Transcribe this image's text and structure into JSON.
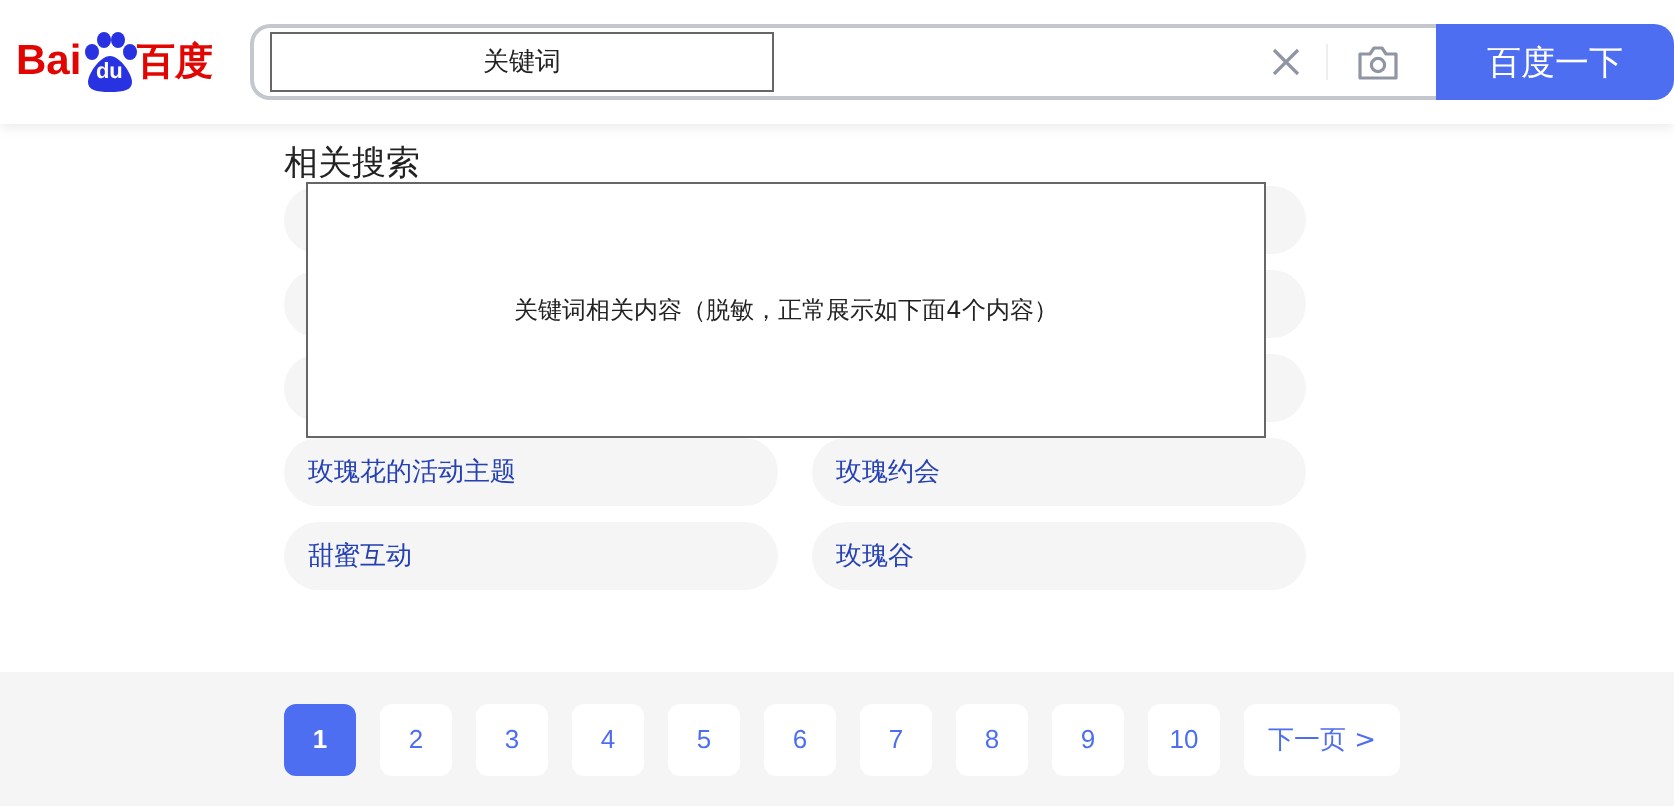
{
  "logo": {
    "text_left": "Bai",
    "text_paw": "du",
    "text_right": "百度"
  },
  "search": {
    "value": "关键词",
    "button": "百度一下"
  },
  "related": {
    "title": "相关搜索",
    "notice": "关键词相关内容（脱敏，正常展示如下面4个内容）",
    "items": [
      {
        "label": "玫瑰花的活动主题"
      },
      {
        "label": "玫瑰约会"
      },
      {
        "label": "甜蜜互动"
      },
      {
        "label": "玫瑰谷"
      }
    ]
  },
  "pagination": {
    "pages": [
      {
        "label": "1",
        "selected": true
      },
      {
        "label": "2",
        "selected": false
      },
      {
        "label": "3",
        "selected": false
      },
      {
        "label": "4",
        "selected": false
      },
      {
        "label": "5",
        "selected": false
      },
      {
        "label": "6",
        "selected": false
      },
      {
        "label": "7",
        "selected": false
      },
      {
        "label": "8",
        "selected": false
      },
      {
        "label": "9",
        "selected": false
      },
      {
        "label": "10",
        "selected": false
      }
    ],
    "next": "下一页 >"
  }
}
